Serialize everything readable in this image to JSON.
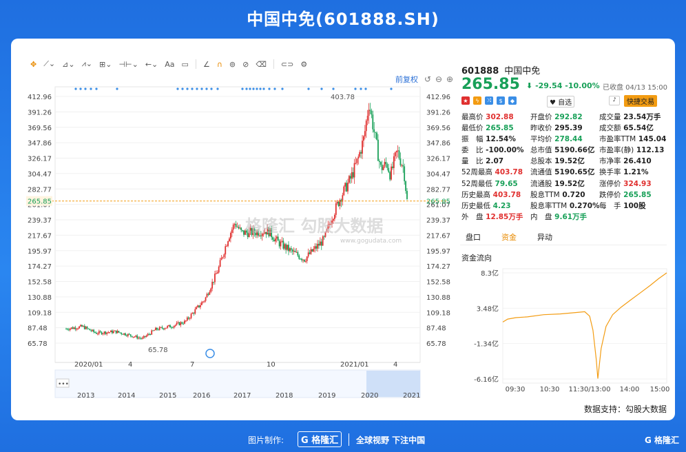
{
  "page_title": "中国中免(601888.SH)",
  "toolbar": {
    "text_tool": "Aa",
    "restore_label": "前复权"
  },
  "chart_data": {
    "type": "candlestick",
    "y_ticks": [
      "412.96",
      "391.26",
      "369.56",
      "347.86",
      "326.17",
      "304.47",
      "282.77",
      "261.07",
      "239.37",
      "217.67",
      "195.97",
      "174.27",
      "152.58",
      "130.88",
      "109.18",
      "87.48",
      "65.78"
    ],
    "ylim": [
      65.78,
      412.96
    ],
    "x_top_labels": [
      "2020/01",
      "4",
      "7",
      "10",
      "2021/01",
      "4"
    ],
    "x_bottom_labels": [
      "2013",
      "2014",
      "2015",
      "2016",
      "2017",
      "2018",
      "2019",
      "2020",
      "2021"
    ],
    "current_price_label": "265.85",
    "high_annotation": "403.78",
    "low_annotation": "65.78",
    "watermark": "格隆汇 勾股大数据",
    "watermark_url": "www.gogudata.com",
    "price_path": [
      [
        0,
        86
      ],
      [
        0.05,
        89
      ],
      [
        0.09,
        80
      ],
      [
        0.15,
        82
      ],
      [
        0.2,
        76
      ],
      [
        0.23,
        72
      ],
      [
        0.27,
        85
      ],
      [
        0.32,
        90
      ],
      [
        0.36,
        96
      ],
      [
        0.42,
        128
      ],
      [
        0.46,
        170
      ],
      [
        0.49,
        215
      ],
      [
        0.51,
        235
      ],
      [
        0.53,
        221
      ],
      [
        0.57,
        222
      ],
      [
        0.61,
        224
      ],
      [
        0.64,
        208
      ],
      [
        0.68,
        195
      ],
      [
        0.72,
        184
      ],
      [
        0.75,
        198
      ],
      [
        0.78,
        212
      ],
      [
        0.8,
        240
      ],
      [
        0.83,
        272
      ],
      [
        0.86,
        298
      ],
      [
        0.88,
        322
      ],
      [
        0.9,
        355
      ],
      [
        0.915,
        405
      ],
      [
        0.93,
        365
      ],
      [
        0.95,
        312
      ],
      [
        0.97,
        318
      ],
      [
        0.98,
        302
      ],
      [
        1.0,
        336
      ],
      [
        1.02,
        312
      ],
      [
        1.03,
        266
      ]
    ]
  },
  "quote": {
    "code": "601888",
    "name": "中国中免",
    "price": "265.85",
    "arrow": "⬇",
    "change": "-29.54",
    "change_pct": "-10.00%",
    "closed_label": "已收盘 04/13 15:00",
    "fav_label": "自选",
    "quick_trade": "快捷交易",
    "icons": [
      "flag-icon",
      "lightning-icon",
      "shuffle-icon",
      "dollar-icon",
      "tag-icon"
    ],
    "rows": [
      [
        {
          "k": "最高价",
          "v": "302.88",
          "c": "red"
        },
        {
          "k": "开盘价",
          "v": "292.82",
          "c": "green"
        },
        {
          "k": "成交量",
          "v": "23.54万手",
          "c": "blk"
        }
      ],
      [
        {
          "k": "最低价",
          "v": "265.85",
          "c": "green"
        },
        {
          "k": "昨收价",
          "v": "295.39",
          "c": "blk"
        },
        {
          "k": "成交额",
          "v": "65.54亿",
          "c": "blk"
        }
      ],
      [
        {
          "k": "振　幅",
          "v": "12.54%",
          "c": "blk"
        },
        {
          "k": "平均价",
          "v": "278.44",
          "c": "green"
        },
        {
          "k": "市盈率TTM",
          "v": "145.04",
          "c": "blk"
        }
      ],
      [
        {
          "k": "委　比",
          "v": "-100.00%",
          "c": "blk"
        },
        {
          "k": "总市值",
          "v": "5190.66亿",
          "c": "blk"
        },
        {
          "k": "市盈率(静)",
          "v": "112.13",
          "c": "blk"
        }
      ],
      [
        {
          "k": "量　比",
          "v": "2.07",
          "c": "blk"
        },
        {
          "k": "总股本",
          "v": "19.52亿",
          "c": "blk"
        },
        {
          "k": "市净率",
          "v": "26.410",
          "c": "blk"
        }
      ],
      [
        {
          "k": "52周最高",
          "v": "403.78",
          "c": "red"
        },
        {
          "k": "流通值",
          "v": "5190.65亿",
          "c": "blk"
        },
        {
          "k": "换手率",
          "v": "1.21%",
          "c": "blk"
        }
      ],
      [
        {
          "k": "52周最低",
          "v": "79.65",
          "c": "green"
        },
        {
          "k": "流通股",
          "v": "19.52亿",
          "c": "blk"
        },
        {
          "k": "涨停价",
          "v": "324.93",
          "c": "red"
        }
      ],
      [
        {
          "k": "历史最高",
          "v": "403.78",
          "c": "red"
        },
        {
          "k": "股息TTM",
          "v": "0.720",
          "c": "blk"
        },
        {
          "k": "跌停价",
          "v": "265.85",
          "c": "green"
        }
      ],
      [
        {
          "k": "历史最低",
          "v": "4.23",
          "c": "green"
        },
        {
          "k": "股息率TTM",
          "v": "0.270%",
          "c": "blk"
        },
        {
          "k": "每　手",
          "v": "100股",
          "c": "blk"
        }
      ],
      [
        {
          "k": "外　盘",
          "v": "12.85万手",
          "c": "red"
        },
        {
          "k": "内　盘",
          "v": "9.61万手",
          "c": "green"
        },
        {
          "k": "",
          "v": "",
          "c": "blk"
        }
      ]
    ]
  },
  "tabs": [
    "盘口",
    "资金",
    "异动"
  ],
  "fund_flow": {
    "title": "资金流向",
    "y_labels": [
      "8.3亿",
      "3.48亿",
      "-1.34亿",
      "-6.16亿"
    ],
    "x_labels": [
      "09:30",
      "10:30",
      "11:30/13:00",
      "14:00",
      "15:00"
    ],
    "ylim": [
      -6.16,
      8.3
    ],
    "values": [
      [
        0,
        1.6
      ],
      [
        0.03,
        2.0
      ],
      [
        0.08,
        2.2
      ],
      [
        0.15,
        2.3
      ],
      [
        0.25,
        2.6
      ],
      [
        0.35,
        2.7
      ],
      [
        0.45,
        2.9
      ],
      [
        0.5,
        3.0
      ],
      [
        0.53,
        2.4
      ],
      [
        0.55,
        0.5
      ],
      [
        0.57,
        -3.5
      ],
      [
        0.58,
        -6.1
      ],
      [
        0.6,
        -2.0
      ],
      [
        0.63,
        1.0
      ],
      [
        0.67,
        2.6
      ],
      [
        0.72,
        3.6
      ],
      [
        0.78,
        4.6
      ],
      [
        0.84,
        5.6
      ],
      [
        0.9,
        6.6
      ],
      [
        0.95,
        7.5
      ],
      [
        1.0,
        8.3
      ]
    ]
  },
  "source": "数据支持：勾股大数据",
  "footer": {
    "made_by": "图片制作:",
    "logo": "G 格隆汇",
    "slogan": "全球视野 下注中国",
    "corner": "G 格隆汇"
  }
}
